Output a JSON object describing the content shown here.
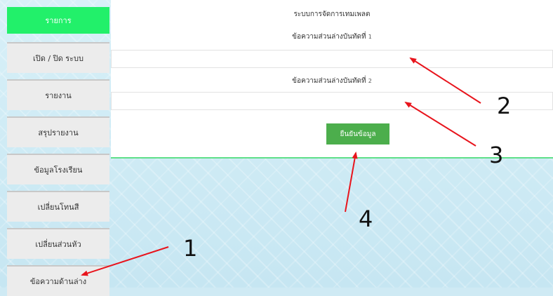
{
  "sidebar": {
    "title": "รายการ",
    "items": [
      {
        "label": "เปิด / ปิด ระบบ"
      },
      {
        "label": "รายงาน"
      },
      {
        "label": "สรุปรายงาน"
      },
      {
        "label": "ข้อมูลโรงเรียน"
      },
      {
        "label": "เปลี่ยนโทนสี"
      },
      {
        "label": "เปลี่ยนส่วนหัว"
      },
      {
        "label": "ข้อความด้านล่าง"
      }
    ]
  },
  "main": {
    "title": "ระบบการจัดการเทมเพลต",
    "field1": {
      "label": "ข้อความส่วนล่างบันทัดที่",
      "number": "1",
      "value": ""
    },
    "field2": {
      "label": "ข้อความส่วนล่างบันทัดที่",
      "number": "2",
      "value": ""
    },
    "submit_label": "ยืนยันข้อมูล"
  },
  "annotations": {
    "numbers": [
      "1",
      "2",
      "3",
      "4"
    ],
    "arrow_color": "#e8141c"
  },
  "colors": {
    "sidebar_title_bg": "#22f06a",
    "button_bg": "#4cae4c",
    "divider": "#5fe08a"
  }
}
